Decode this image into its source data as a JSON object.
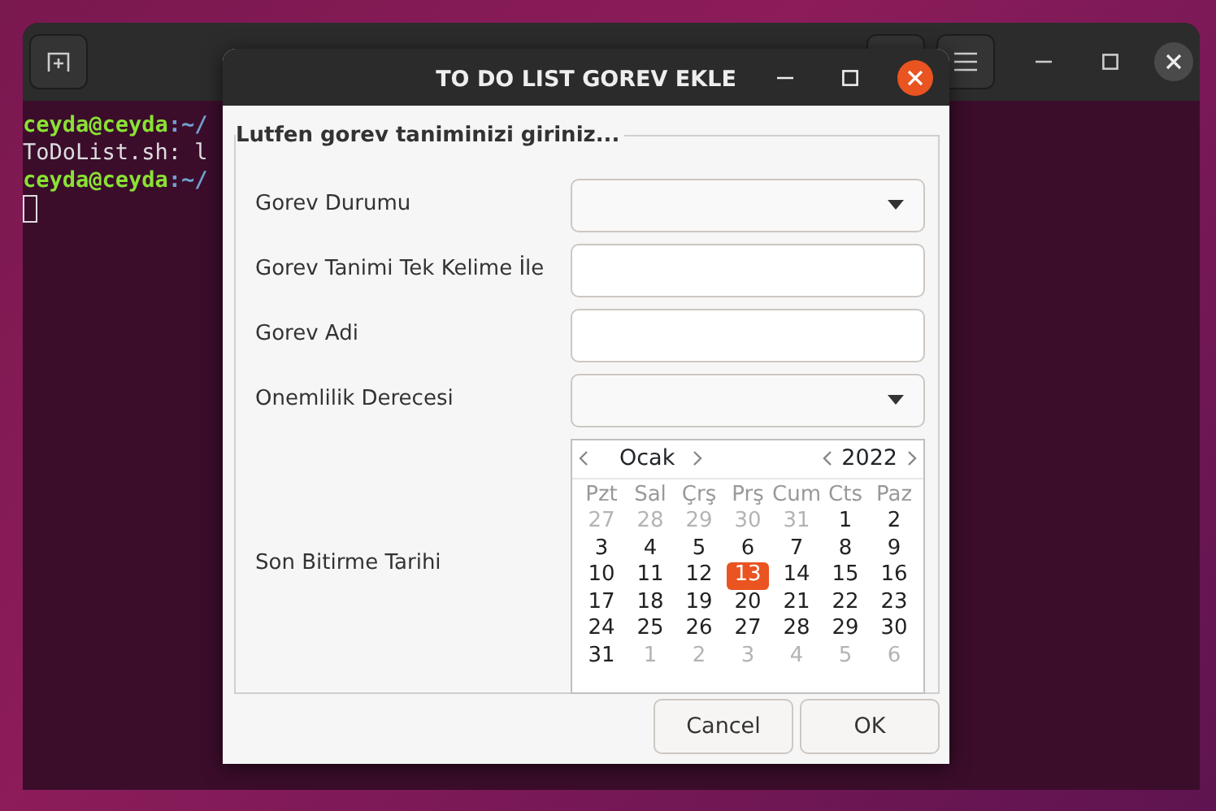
{
  "terminal": {
    "lines": [
      {
        "prompt": "ceyda@ceyda",
        "rest": ":~/"
      },
      {
        "text": "ToDoList.sh: l"
      },
      {
        "prompt": "ceyda@ceyda",
        "rest": ":~/"
      }
    ]
  },
  "dialog": {
    "title": "TO DO LIST GOREV EKLE",
    "frame_label": "Lutfen gorev taniminizi giriniz...",
    "fields": [
      {
        "label": "Gorev Durumu",
        "kind": "combo"
      },
      {
        "label": "Gorev Tanimi Tek Kelime İle",
        "kind": "entry"
      },
      {
        "label": "Gorev Adi",
        "kind": "entry"
      },
      {
        "label": "Onemlilik Derecesi",
        "kind": "combo"
      },
      {
        "label": "Son Bitirme Tarihi",
        "kind": "calendar"
      }
    ],
    "calendar": {
      "month": "Ocak",
      "year": "2022",
      "weekdays": [
        "Pzt",
        "Sal",
        "Çrş",
        "Prş",
        "Cum",
        "Cts",
        "Paz"
      ],
      "weeks": [
        [
          {
            "day": "27",
            "muted": true,
            "selected": false
          },
          {
            "day": "28",
            "muted": true,
            "selected": false
          },
          {
            "day": "29",
            "muted": true,
            "selected": false
          },
          {
            "day": "30",
            "muted": true,
            "selected": false
          },
          {
            "day": "31",
            "muted": true,
            "selected": false
          },
          {
            "day": "1",
            "muted": false,
            "selected": false
          },
          {
            "day": "2",
            "muted": false,
            "selected": false
          }
        ],
        [
          {
            "day": "3",
            "muted": false,
            "selected": false
          },
          {
            "day": "4",
            "muted": false,
            "selected": false
          },
          {
            "day": "5",
            "muted": false,
            "selected": false
          },
          {
            "day": "6",
            "muted": false,
            "selected": false
          },
          {
            "day": "7",
            "muted": false,
            "selected": false
          },
          {
            "day": "8",
            "muted": false,
            "selected": false
          },
          {
            "day": "9",
            "muted": false,
            "selected": false
          }
        ],
        [
          {
            "day": "10",
            "muted": false,
            "selected": false
          },
          {
            "day": "11",
            "muted": false,
            "selected": false
          },
          {
            "day": "12",
            "muted": false,
            "selected": false
          },
          {
            "day": "13",
            "muted": false,
            "selected": true
          },
          {
            "day": "14",
            "muted": false,
            "selected": false
          },
          {
            "day": "15",
            "muted": false,
            "selected": false
          },
          {
            "day": "16",
            "muted": false,
            "selected": false
          }
        ],
        [
          {
            "day": "17",
            "muted": false,
            "selected": false
          },
          {
            "day": "18",
            "muted": false,
            "selected": false
          },
          {
            "day": "19",
            "muted": false,
            "selected": false
          },
          {
            "day": "20",
            "muted": false,
            "selected": false
          },
          {
            "day": "21",
            "muted": false,
            "selected": false
          },
          {
            "day": "22",
            "muted": false,
            "selected": false
          },
          {
            "day": "23",
            "muted": false,
            "selected": false
          }
        ],
        [
          {
            "day": "24",
            "muted": false,
            "selected": false
          },
          {
            "day": "25",
            "muted": false,
            "selected": false
          },
          {
            "day": "26",
            "muted": false,
            "selected": false
          },
          {
            "day": "27",
            "muted": false,
            "selected": false
          },
          {
            "day": "28",
            "muted": false,
            "selected": false
          },
          {
            "day": "29",
            "muted": false,
            "selected": false
          },
          {
            "day": "30",
            "muted": false,
            "selected": false
          }
        ],
        [
          {
            "day": "31",
            "muted": false,
            "selected": false
          },
          {
            "day": "1",
            "muted": true,
            "selected": false
          },
          {
            "day": "2",
            "muted": true,
            "selected": false
          },
          {
            "day": "3",
            "muted": true,
            "selected": false
          },
          {
            "day": "4",
            "muted": true,
            "selected": false
          },
          {
            "day": "5",
            "muted": true,
            "selected": false
          },
          {
            "day": "6",
            "muted": true,
            "selected": false
          }
        ]
      ]
    },
    "buttons": [
      "Cancel",
      "OK"
    ]
  }
}
